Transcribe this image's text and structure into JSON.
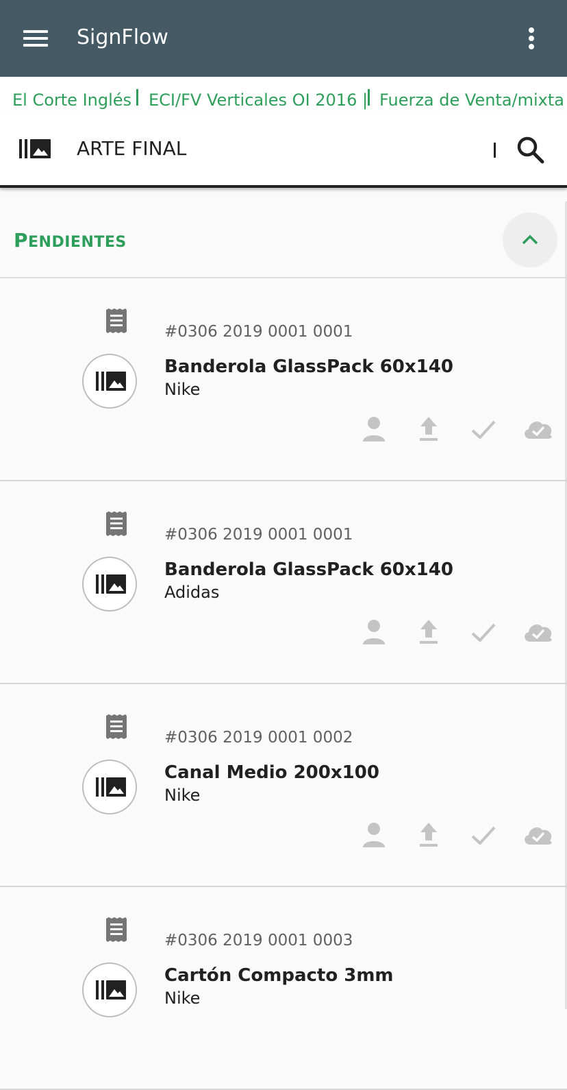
{
  "app": {
    "title": "SignFlow"
  },
  "breadcrumb": {
    "items": [
      "El Corte Inglés",
      "ECI/FV Verticales OI 2016 |",
      "Fuerza de Venta/mixta"
    ]
  },
  "section": {
    "title": "ARTE FINAL"
  },
  "group": {
    "title_first": "P",
    "title_rest": "ENDIENTES"
  },
  "cards": [
    {
      "code": "#0306 2019 0001 0001",
      "title": "Banderola GlassPack 60x140",
      "client": "Nike"
    },
    {
      "code": "#0306 2019 0001 0001",
      "title": "Banderola GlassPack 60x140",
      "client": "Adidas"
    },
    {
      "code": "#0306 2019 0001 0002",
      "title": "Canal Medio 200x100",
      "client": "Nike"
    },
    {
      "code": "#0306 2019 0001 0003",
      "title": "Cartón Compacto 3mm",
      "client": "Nike"
    }
  ],
  "colors": {
    "appbar": "#455a64",
    "accent": "#2e9e5b",
    "action_icon": "#c4c4c4",
    "doc_icon": "#757575"
  },
  "icons": {
    "menu": "menu-icon",
    "more": "more-vert-icon",
    "section": "artwork-gallery-icon",
    "search": "search-icon",
    "collapse": "chevron-up-icon",
    "card_doc": "receipt-document-icon",
    "card_thumb": "artwork-gallery-icon",
    "actions": [
      "person-icon",
      "upload-icon",
      "check-icon",
      "cloud-done-icon"
    ]
  }
}
